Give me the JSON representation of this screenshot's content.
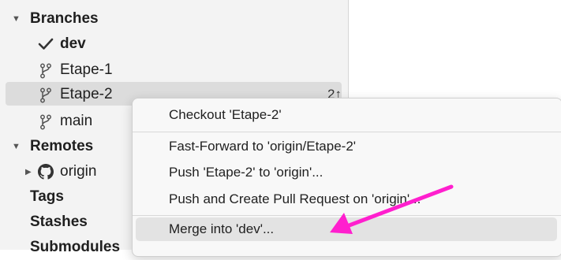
{
  "sidebar": {
    "branches_header": "Branches",
    "branches": [
      {
        "label": "dev",
        "current": true
      },
      {
        "label": "Etape-1"
      },
      {
        "label": "Etape-2",
        "selected": true,
        "badge": "2↑"
      },
      {
        "label": "main"
      }
    ],
    "remotes_header": "Remotes",
    "remotes": [
      {
        "label": "origin"
      }
    ],
    "tags": "Tags",
    "stashes": "Stashes",
    "submodules": "Submodules"
  },
  "context_menu": {
    "items": [
      "Checkout 'Etape-2'",
      "Fast-Forward to 'origin/Etape-2'",
      "Push 'Etape-2' to 'origin'...",
      "Push and Create Pull Request on 'origin'...",
      "Merge into 'dev'..."
    ],
    "highlighted_index": 4
  },
  "colors": {
    "annotation_arrow": "#ff1fce",
    "sidebar_bg": "#f3f3f3",
    "selection_bg": "#dcdcdc"
  },
  "icons": [
    "caret-down-icon",
    "caret-right-icon",
    "check-icon",
    "branch-icon",
    "github-icon"
  ]
}
